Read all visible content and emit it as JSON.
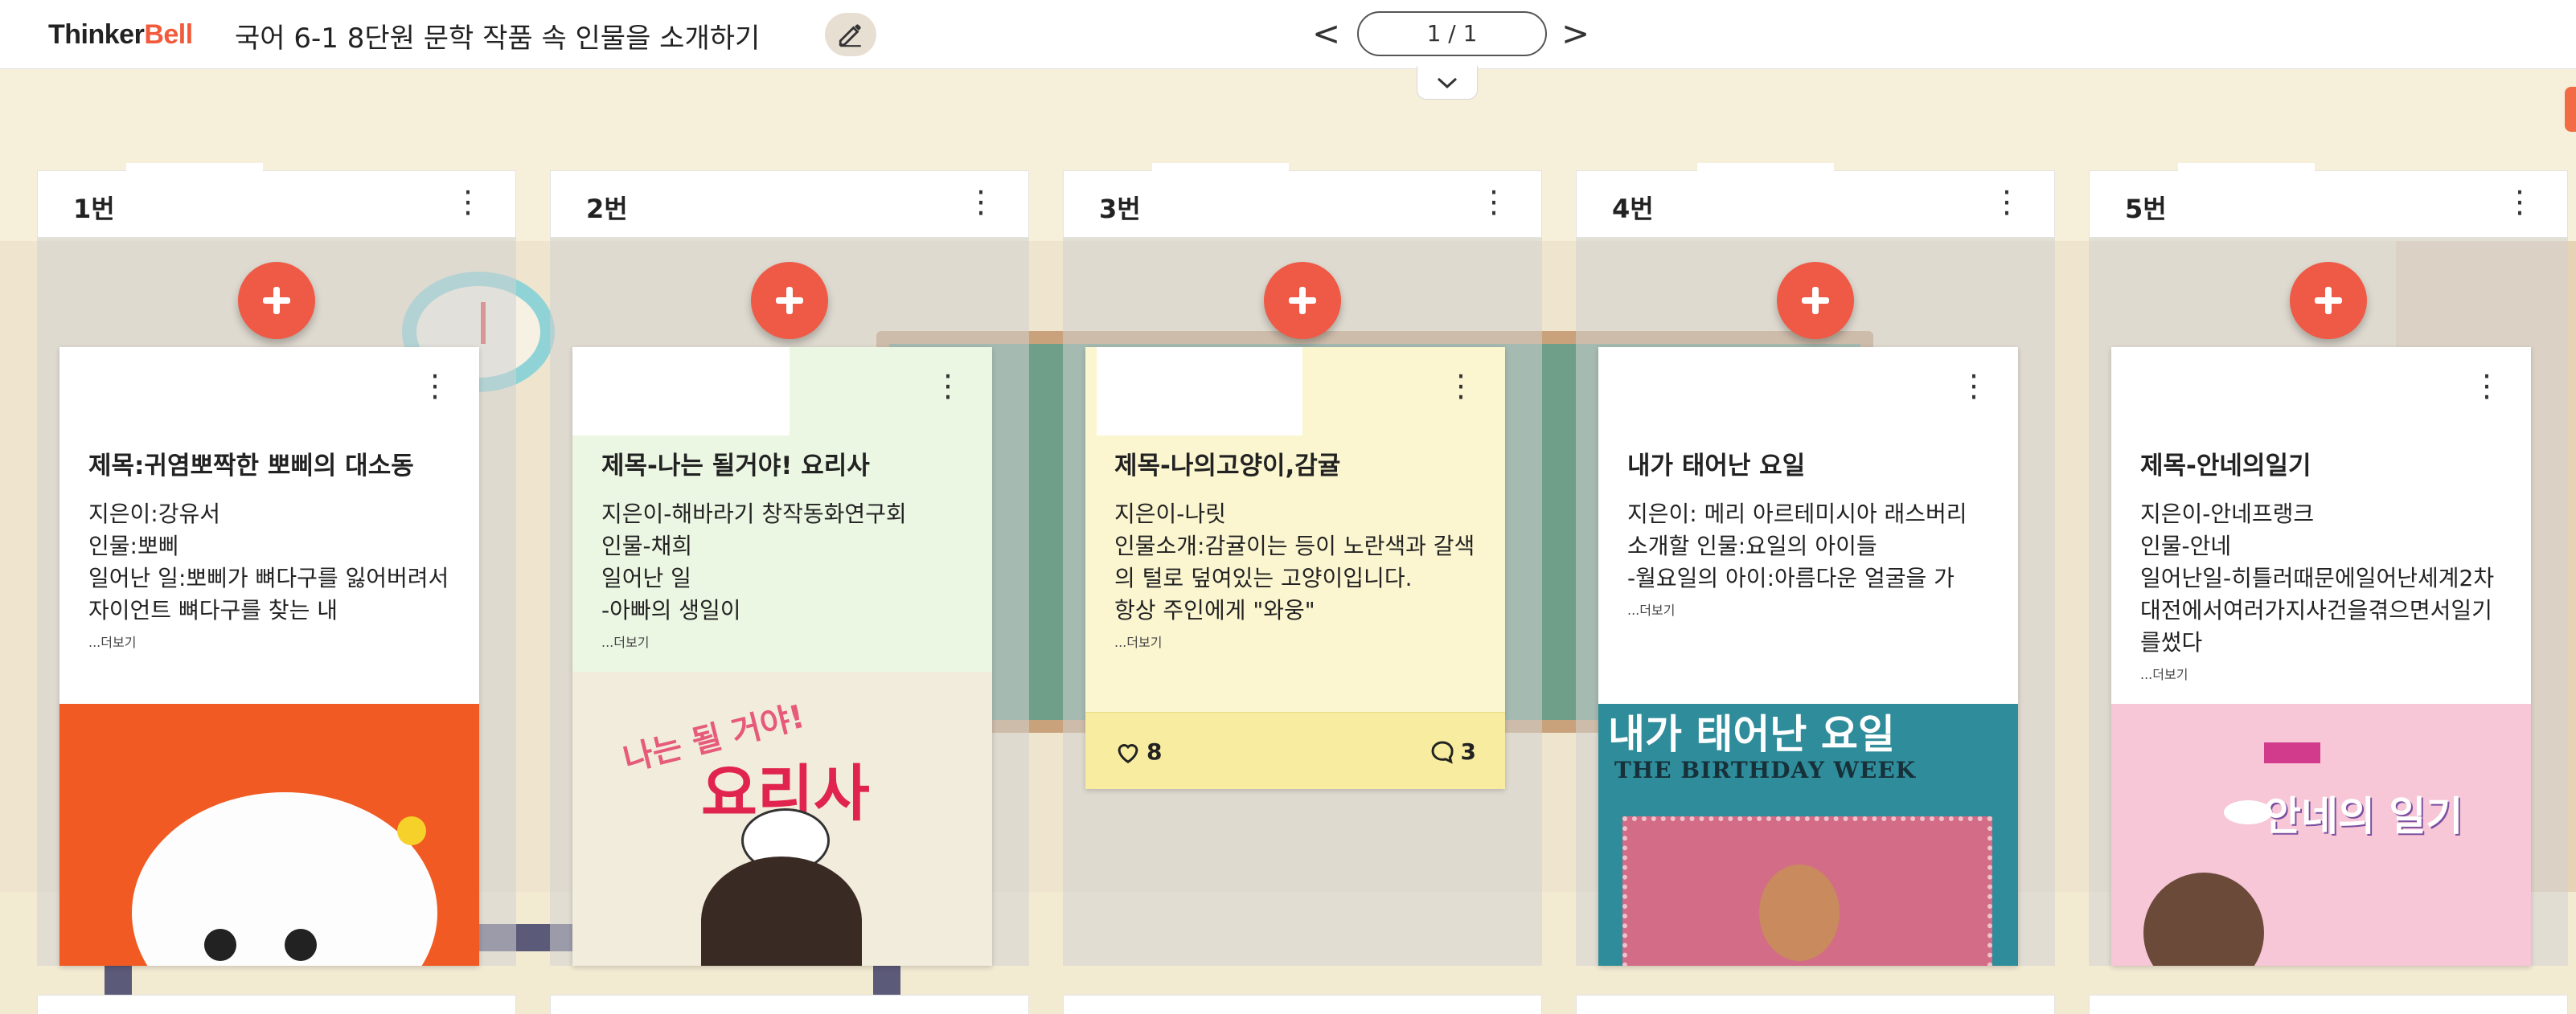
{
  "header": {
    "logo_part1": "Thinker",
    "logo_part2": "Bell",
    "board_title": "국어 6-1 8단원 문학 작품 속 인물을 소개하기",
    "pager_prev": "<",
    "pager_text": "1 / 1",
    "pager_next": ">"
  },
  "colors": {
    "accent": "#f15a3b",
    "add_button": "#ee5a45",
    "card_green": "#ecf7e3",
    "card_yellow": "#fbf6d0",
    "footer_yellow": "#f7ec9f"
  },
  "columns": [
    {
      "title": "1번",
      "card": {
        "title": "제목:귀염뽀짝한 뽀삐의 대소동",
        "body": "지은이:강유서\n인물:뽀삐\n일어난 일:뽀삐가 뼈다구를 잃어버려서 자이언트 뼈다구를 찾는 내",
        "more": "...더보기"
      }
    },
    {
      "title": "2번",
      "card": {
        "title": "제목-나는 될거야! 요리사",
        "body": "지은이-해바라기 창작동화연구회\n인물-채희\n일어난 일\n-아빠의 생일이",
        "more": "...더보기",
        "image_text_small": "나는 될 거야!",
        "image_text_big": "요리사"
      }
    },
    {
      "title": "3번",
      "card": {
        "title": "제목-나의고양이,감귤",
        "body": "지은이-나릿\n인물소개:감귤이는 등이 노란색과 갈색의 털로 덮여있는 고양이입니다.\n항상 주인에게 \"와웅\"",
        "more": "...더보기",
        "likes": "8",
        "comments": "3"
      }
    },
    {
      "title": "4번",
      "card": {
        "title": "내가 태어난 요일",
        "body": "지은이: 메리 아르테미시아 래스버리\n소개할 인물:요일의 아이들\n-월요일의 아이:아름다운 얼굴을 가",
        "more": "...더보기",
        "image_text_ko": "내가 태어난 요일",
        "image_text_en": "THE BIRTHDAY WEEK"
      }
    },
    {
      "title": "5번",
      "card": {
        "title": "제목-안네의일기",
        "body": "지은이-안네프랭크\n인물-안네\n일어난일-히틀러때문에일어난세계2차대전에서여러가지사건을겪으면서일기를썼다",
        "more": "...더보기",
        "image_text": "안네의 일기"
      }
    }
  ]
}
